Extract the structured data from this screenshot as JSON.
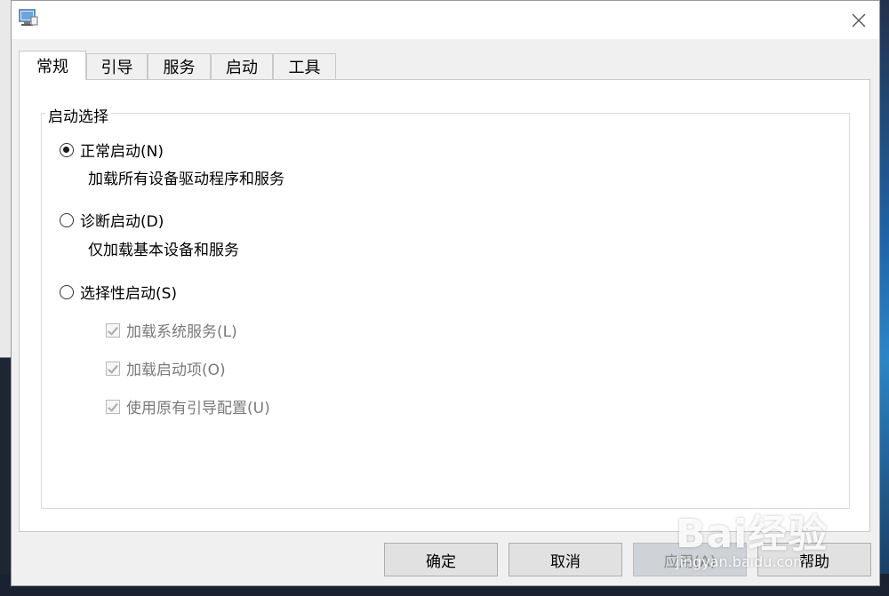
{
  "tabs": [
    {
      "label": "常规",
      "active": true
    },
    {
      "label": "引导",
      "active": false
    },
    {
      "label": "服务",
      "active": false
    },
    {
      "label": "启动",
      "active": false
    },
    {
      "label": "工具",
      "active": false
    }
  ],
  "group": {
    "title": "启动选择",
    "options": [
      {
        "label": "正常启动(N)",
        "checked": true,
        "description": "加载所有设备驱动程序和服务"
      },
      {
        "label": "诊断启动(D)",
        "checked": false,
        "description": "仅加载基本设备和服务"
      },
      {
        "label": "选择性启动(S)",
        "checked": false
      }
    ],
    "selective_items": [
      {
        "label": "加载系统服务(L)",
        "checked": true,
        "enabled": false
      },
      {
        "label": "加载启动项(O)",
        "checked": true,
        "enabled": false
      },
      {
        "label": "使用原有引导配置(U)",
        "checked": true,
        "enabled": false
      }
    ]
  },
  "buttons": {
    "ok": "确定",
    "cancel": "取消",
    "apply": "应用(A)",
    "help": "帮助"
  },
  "watermark": {
    "logo": "Bai经验",
    "url": "jingyan.baidu.com"
  },
  "icons": {
    "close": "close-icon",
    "app": "msconfig-app-icon"
  }
}
